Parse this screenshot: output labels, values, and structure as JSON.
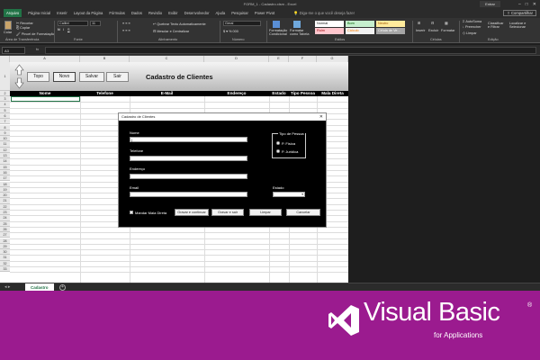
{
  "window": {
    "title": "FORM_1 - Cadastro.xlsm  -  Excel",
    "signin": "Entrar"
  },
  "menu": {
    "tabs": [
      "Arquivo",
      "Página Inicial",
      "Inserir",
      "Layout da Página",
      "Fórmulas",
      "Dados",
      "Revisão",
      "Exibir",
      "Desenvolvedor",
      "Ajuda",
      "Pesquisar",
      "Power Pivot"
    ],
    "active_index": 0,
    "search": "Diga-me o que você deseja fazer",
    "share": "Compartilhar"
  },
  "ribbon": {
    "clipboard": {
      "paste": "Colar",
      "cut": "Recortar",
      "copy": "Copiar",
      "format_painter": "Pincel de Formatação",
      "label": "Área de Transferência"
    },
    "font": {
      "name": "Calibri",
      "size": "11",
      "label": "Fonte"
    },
    "alignment": {
      "wrap": "Quebrar Texto Automaticamente",
      "merge": "Mesclar e Centralizar",
      "label": "Alinhamento"
    },
    "number": {
      "format": "Geral",
      "label": "Número"
    },
    "styles": {
      "conditional": "Formatação Condicional",
      "table": "Formatar como Tabela",
      "cells": [
        {
          "label": "Normal",
          "bg": "#ffffff"
        },
        {
          "label": "Bom",
          "bg": "#c6efce"
        },
        {
          "label": "Neutro",
          "bg": "#ffeb9c"
        },
        {
          "label": "Ruim",
          "bg": "#ffc7ce"
        },
        {
          "label": "Cálculo",
          "bg": "#f2f2f2"
        },
        {
          "label": "Célula de Ve...",
          "bg": "#a5a5a5"
        }
      ],
      "label": "Estilos"
    },
    "cells": {
      "insert": "Inserir",
      "delete": "Excluir",
      "format": "Formatar",
      "label": "Células"
    },
    "editing": {
      "autosum": "AutoSoma",
      "fill": "Preencher",
      "clear": "Limpar",
      "sort": "Classificar e Filtrar",
      "find": "Localizar e Selecionar",
      "label": "Edição"
    }
  },
  "formula_bar": {
    "name_box": "A3",
    "fx": "fx",
    "value": ""
  },
  "sheet": {
    "columns": [
      "A",
      "B",
      "C",
      "D",
      "E",
      "F",
      "G"
    ],
    "rows": [
      "1",
      "2",
      "3",
      "4",
      "5",
      "6",
      "7",
      "8",
      "9",
      "10",
      "11",
      "12",
      "13",
      "14",
      "15",
      "16",
      "17",
      "18",
      "19",
      "20",
      "21",
      "22",
      "23",
      "24",
      "25",
      "26",
      "27",
      "28",
      "29",
      "30",
      "31",
      "32",
      "33"
    ],
    "buttons": [
      "Topo",
      "Novo",
      "Salvar",
      "Sair"
    ],
    "title": "Cadastro de Clientes",
    "headers": [
      "Nome",
      "Telefone",
      "E-Mail",
      "Endereço",
      "Estado",
      "Tipo Pessoa",
      "Mala Direta"
    ]
  },
  "dialog": {
    "title": "Cadastro de Clientes",
    "close": "✕",
    "fields": {
      "nome": {
        "label": "Nome",
        "value": "|"
      },
      "telefone": {
        "label": "Telefone",
        "value": ""
      },
      "endereco": {
        "label": "Endereço",
        "value": ""
      },
      "email": {
        "label": "Email",
        "value": ""
      },
      "estado": {
        "label": "Estado",
        "value": ""
      }
    },
    "tipo_pessoa": {
      "label": "Tipo de Pessoa",
      "options": [
        "P. Física",
        "P. Jurídica"
      ]
    },
    "mala_direta": "Mandar Mala Direta",
    "buttons": [
      "Gravar e continuar",
      "Gravar e sair",
      "Limpar",
      "Cancelar"
    ]
  },
  "sheet_tabs": {
    "active": "Cadastro",
    "add": "+"
  },
  "banner": {
    "title": "Visual Basic",
    "registered": "®",
    "subtitle": "for Applications",
    "bg": "#9b1b8f"
  }
}
